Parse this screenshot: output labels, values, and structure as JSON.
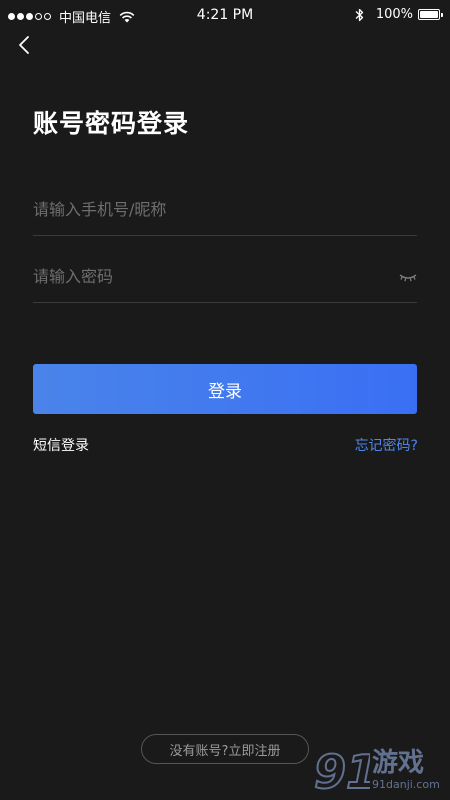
{
  "status_bar": {
    "carrier": "中国电信",
    "time": "4:21 PM",
    "battery": "100%",
    "battery_level": 1.0,
    "signal_filled": 3,
    "signal_total": 5
  },
  "title": "账号密码登录",
  "account_field": {
    "placeholder": "请输入手机号/昵称",
    "value": ""
  },
  "password_field": {
    "placeholder": "请输入密码",
    "value": ""
  },
  "login_button": {
    "label": "登录"
  },
  "sms_login": {
    "label": "短信登录"
  },
  "forgot_password": {
    "label": "忘记密码?"
  },
  "register": {
    "prompt": "没有账号?",
    "action": "立即注册"
  },
  "watermark": {
    "logo": "91",
    "text": "游戏",
    "sub": "91danji.com"
  },
  "colors": {
    "background": "#1a1a1a",
    "accent": "#3a6ff4",
    "link": "#4f86f0"
  },
  "icons": {
    "back": "chevron-left-icon",
    "eye": "eye-closed-icon",
    "wifi": "wifi-icon",
    "bluetooth": "bluetooth-icon",
    "battery": "battery-icon"
  }
}
